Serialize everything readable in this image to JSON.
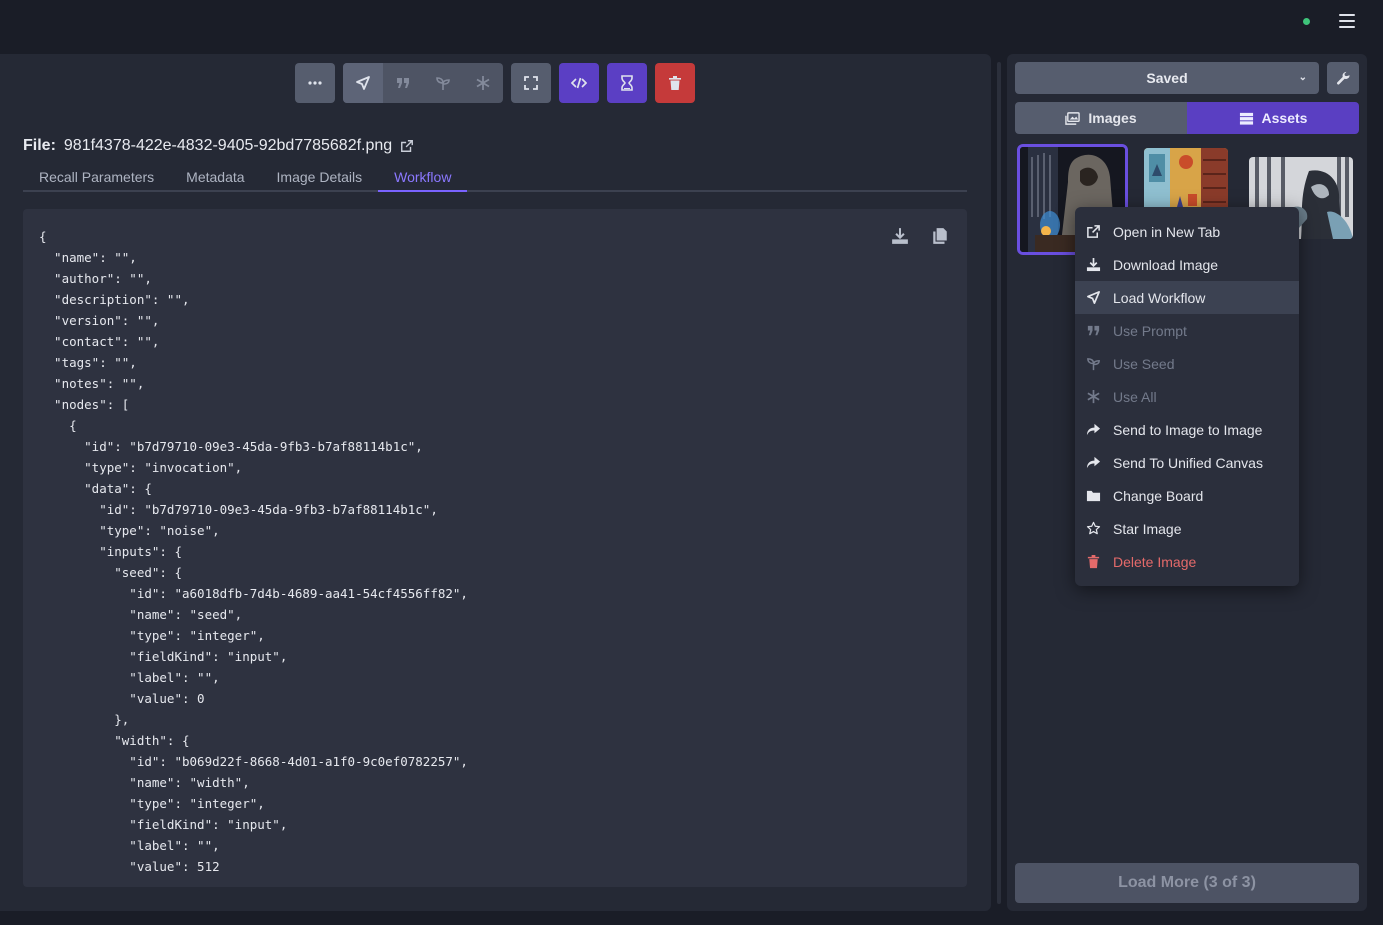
{
  "toolbar": {
    "more": "more-icon",
    "load_workflow": "load-workflow-icon",
    "use_prompt": "quote-icon",
    "use_seed": "seedling-icon",
    "use_all": "asterisk-icon",
    "fullscreen": "expand-icon",
    "code": "code-icon",
    "progress": "hourglass-icon",
    "delete": "trash-icon"
  },
  "file": {
    "label": "File:",
    "name": "981f4378-422e-4832-9405-92bd7785682f.png"
  },
  "tabs": [
    "Recall Parameters",
    "Metadata",
    "Image Details",
    "Workflow"
  ],
  "active_tab": "Workflow",
  "workflow_json": "{\n  \"name\": \"\",\n  \"author\": \"\",\n  \"description\": \"\",\n  \"version\": \"\",\n  \"contact\": \"\",\n  \"tags\": \"\",\n  \"notes\": \"\",\n  \"nodes\": [\n    {\n      \"id\": \"b7d79710-09e3-45da-9fb3-b7af88114b1c\",\n      \"type\": \"invocation\",\n      \"data\": {\n        \"id\": \"b7d79710-09e3-45da-9fb3-b7af88114b1c\",\n        \"type\": \"noise\",\n        \"inputs\": {\n          \"seed\": {\n            \"id\": \"a6018dfb-7d4b-4689-aa41-54cf4556ff82\",\n            \"name\": \"seed\",\n            \"type\": \"integer\",\n            \"fieldKind\": \"input\",\n            \"label\": \"\",\n            \"value\": 0\n          },\n          \"width\": {\n            \"id\": \"b069d22f-8668-4d01-a1f0-9c0ef0782257\",\n            \"name\": \"width\",\n            \"type\": \"integer\",\n            \"fieldKind\": \"input\",\n            \"label\": \"\",\n            \"value\": 512",
  "gallery": {
    "board": "Saved",
    "images_tab": "Images",
    "assets_tab": "Assets",
    "load_more": "Load More (3 of 3)"
  },
  "context_menu": [
    {
      "label": "Open in New Tab",
      "icon": "external-link-icon"
    },
    {
      "label": "Download Image",
      "icon": "download-icon"
    },
    {
      "label": "Load Workflow",
      "icon": "load-workflow-icon"
    },
    {
      "label": "Use Prompt",
      "icon": "quote-icon"
    },
    {
      "label": "Use Seed",
      "icon": "seedling-icon"
    },
    {
      "label": "Use All",
      "icon": "asterisk-icon"
    },
    {
      "label": "Send to Image to Image",
      "icon": "share-icon"
    },
    {
      "label": "Send To Unified Canvas",
      "icon": "share-icon"
    },
    {
      "label": "Change Board",
      "icon": "folder-icon"
    },
    {
      "label": "Star Image",
      "icon": "star-icon"
    },
    {
      "label": "Delete Image",
      "icon": "trash-icon"
    }
  ],
  "colors": {
    "accent": "#5b3fc4",
    "danger": "#c53a3a",
    "status": "#3ec47a"
  }
}
